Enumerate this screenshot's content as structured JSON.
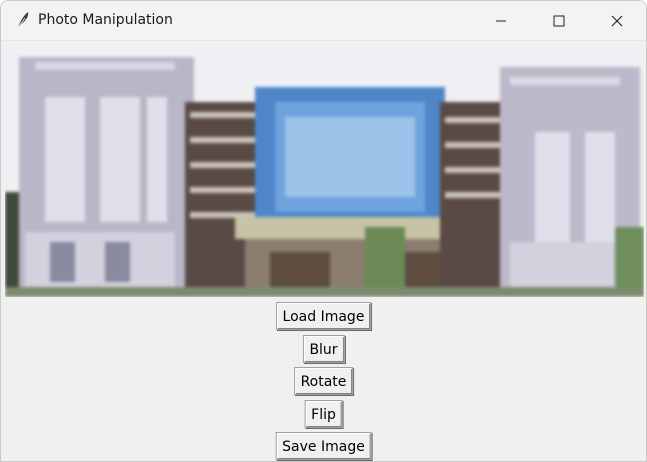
{
  "window": {
    "title": "Photo Manipulation",
    "app_icon": "feather-icon",
    "controls": [
      "minimize-icon",
      "maximize-icon",
      "close-icon"
    ]
  },
  "image": {
    "subject": "blurred photo of a multi-storey building"
  },
  "buttons": {
    "load": "Load Image",
    "blur": "Blur",
    "rotate": "Rotate",
    "flip": "Flip",
    "save": "Save Image"
  },
  "colors": {
    "window_bg": "#f0f0f0",
    "titlebar_bg": "#f3f3f3",
    "glass_facade": "#5b93d2"
  }
}
